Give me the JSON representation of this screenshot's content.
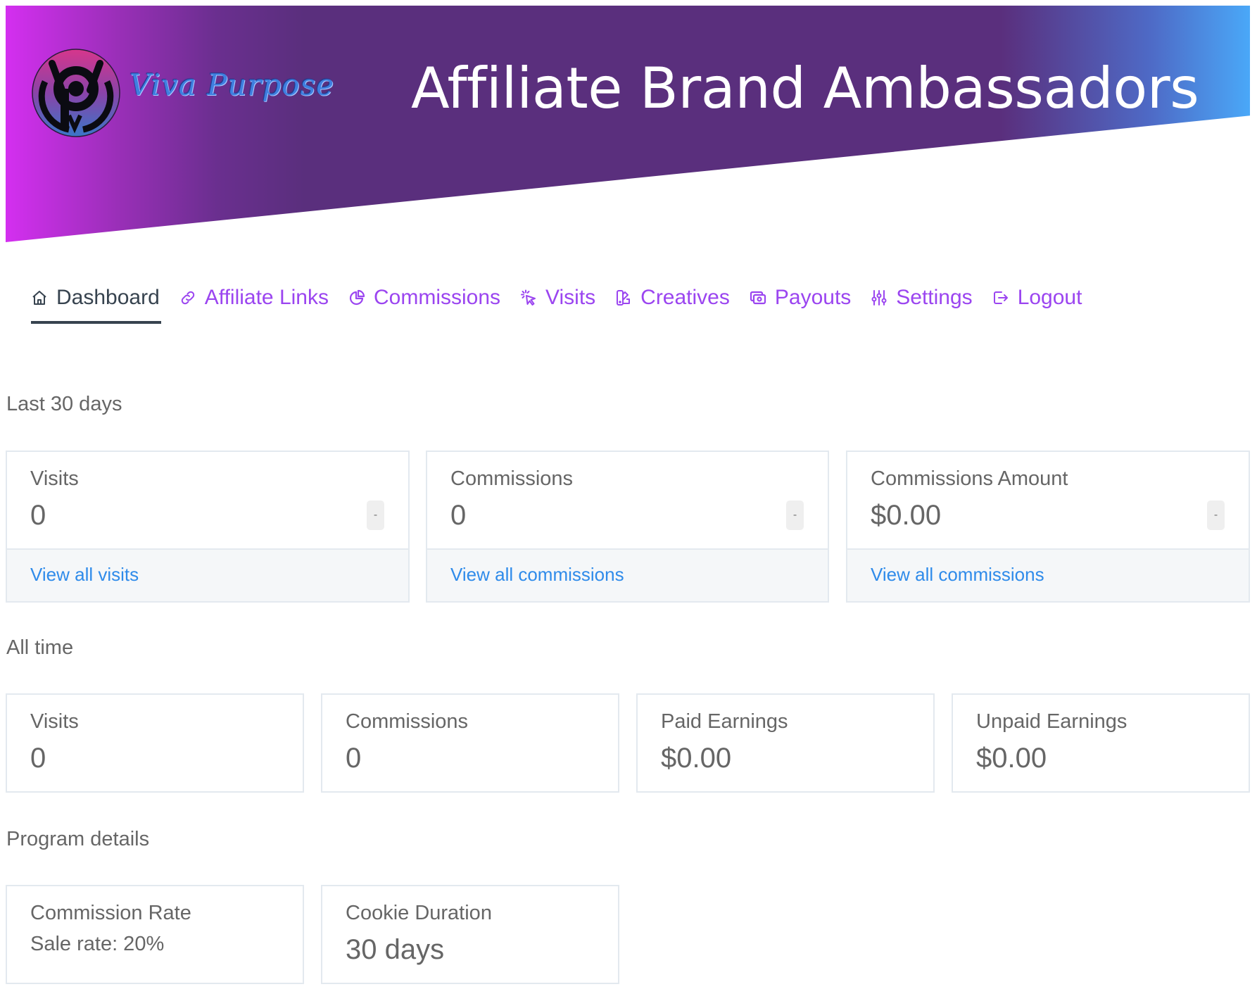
{
  "header": {
    "brand_name": "Viva Purpose",
    "title": "Affiliate Brand Ambassadors",
    "logo_icon": "viva-purpose-logo-icon"
  },
  "colors": {
    "nav_active": "#37434f",
    "nav_link": "#9b45f0",
    "link": "#2f8bea",
    "banner_start": "#d42ff0",
    "banner_mid": "#5a2f7d",
    "banner_end": "#4aa8f8"
  },
  "nav": {
    "items": [
      {
        "label": "Dashboard",
        "icon": "home-icon",
        "active": true
      },
      {
        "label": "Affiliate Links",
        "icon": "link-icon",
        "active": false
      },
      {
        "label": "Commissions",
        "icon": "pie-chart-icon",
        "active": false
      },
      {
        "label": "Visits",
        "icon": "cursor-click-icon",
        "active": false
      },
      {
        "label": "Creatives",
        "icon": "creatives-icon",
        "active": false
      },
      {
        "label": "Payouts",
        "icon": "cash-icon",
        "active": false
      },
      {
        "label": "Settings",
        "icon": "sliders-icon",
        "active": false
      },
      {
        "label": "Logout",
        "icon": "logout-icon",
        "active": false
      }
    ]
  },
  "last30": {
    "label": "Last 30 days",
    "cards": [
      {
        "title": "Visits",
        "value": "0",
        "badge": "-",
        "link": "View all visits"
      },
      {
        "title": "Commissions",
        "value": "0",
        "badge": "-",
        "link": "View all commissions"
      },
      {
        "title": "Commissions Amount",
        "value": "$0.00",
        "badge": "-",
        "link": "View all commissions"
      }
    ]
  },
  "alltime": {
    "label": "All time",
    "cards": [
      {
        "title": "Visits",
        "value": "0"
      },
      {
        "title": "Commissions",
        "value": "0"
      },
      {
        "title": "Paid Earnings",
        "value": "$0.00"
      },
      {
        "title": "Unpaid Earnings",
        "value": "$0.00"
      }
    ]
  },
  "program": {
    "label": "Program details",
    "cards": [
      {
        "title": "Commission Rate",
        "value": "Sale rate: 20%"
      },
      {
        "title": "Cookie Duration",
        "value": "30 days"
      }
    ]
  }
}
